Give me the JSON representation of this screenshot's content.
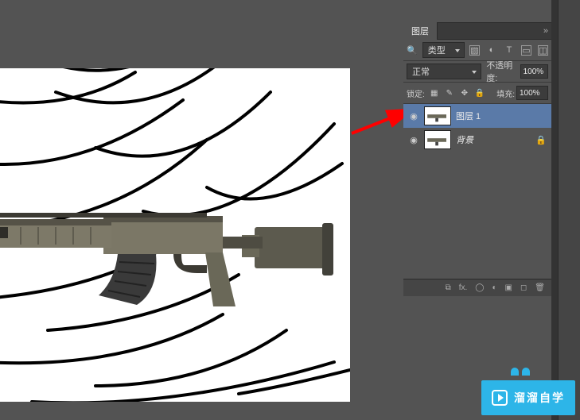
{
  "panel": {
    "title": "图层",
    "filter_label": "类型",
    "blend_mode": "正常",
    "opacity_label": "不透明度:",
    "opacity_value": "100%",
    "lock_label": "锁定:",
    "fill_label": "填充:",
    "fill_value": "100%"
  },
  "layers": [
    {
      "name": "图层 1",
      "visible": true,
      "selected": true,
      "locked": false
    },
    {
      "name": "背景",
      "visible": true,
      "selected": false,
      "locked": true
    }
  ],
  "footer_icons": [
    "link",
    "fx",
    "mask",
    "adjust",
    "group",
    "new",
    "trash"
  ],
  "watermark": {
    "text": "溜溜自学"
  },
  "icons": {
    "eye": "◉",
    "link": "⧉",
    "fx": "fx.",
    "mask": "◯",
    "adjust": "◐",
    "group": "▣",
    "new": "◻",
    "trash": "🗑",
    "image": "▧",
    "adjustIco": "◐",
    "text": "T",
    "shape": "▭",
    "smart": "◫",
    "lockTrans": "▦",
    "lockPaint": "✎",
    "lockMove": "✥",
    "lockAll": "🔒",
    "chevrons": "»"
  }
}
